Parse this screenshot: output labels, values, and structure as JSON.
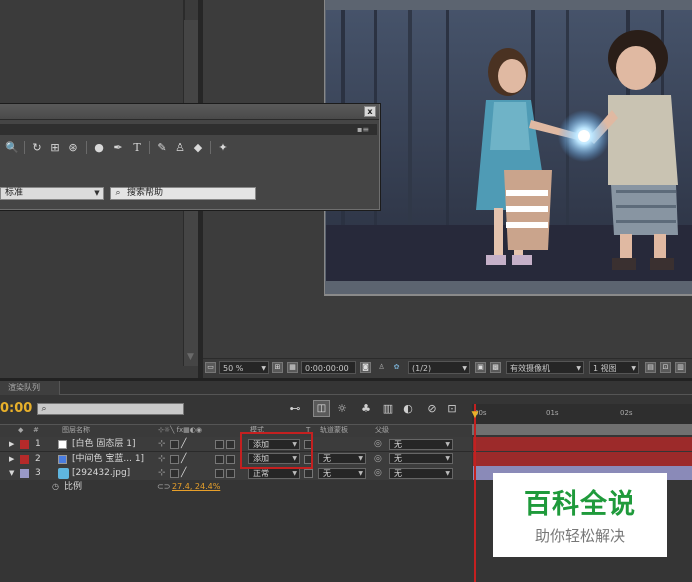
{
  "tools_panel": {
    "workspace_select": "标准",
    "help_search_placeholder": "搜索帮助",
    "close_label": "x",
    "menu_glyph": "▪≡",
    "tools": [
      {
        "name": "zoom-tool-icon",
        "glyph": "🔍"
      },
      {
        "name": "rotate-tool-icon",
        "glyph": "↻"
      },
      {
        "name": "camera-orbit-tool-icon",
        "glyph": "⊞"
      },
      {
        "name": "pan-behind-tool-icon",
        "glyph": "⊛"
      },
      {
        "name": "ellipse-tool-icon",
        "glyph": "●"
      },
      {
        "name": "pen-tool-icon",
        "glyph": "✒"
      },
      {
        "name": "type-tool-icon",
        "glyph": "T"
      },
      {
        "name": "brush-tool-icon",
        "glyph": "✎"
      },
      {
        "name": "clone-stamp-tool-icon",
        "glyph": "♙"
      },
      {
        "name": "eraser-tool-icon",
        "glyph": "◆"
      },
      {
        "name": "puppet-pin-tool-icon",
        "glyph": "✦"
      }
    ]
  },
  "viewer_toolbar": {
    "zoom": "50 %",
    "timecode": "0:00:00:00",
    "resolution": "(1/2)",
    "camera": "有效摄像机",
    "view_layout": "1 视图"
  },
  "timeline": {
    "tab_label": "渲染队列",
    "current_time": "0:00",
    "ruler_ticks": [
      "00s",
      "01s",
      "02s"
    ],
    "columns": {
      "number": "#",
      "layer_name": "图层名称",
      "mode": "模式",
      "trkmat": "T",
      "track_matte": "轨道蒙板",
      "parent": "父级"
    },
    "layers": [
      {
        "index": "1",
        "name": "[白色 固态层 1]",
        "mode": "添加",
        "track_matte": "",
        "parent": "无",
        "label_color": "#b52a2a",
        "swatch_color": "#ffffff",
        "bar_color": "#9c2a2a"
      },
      {
        "index": "2",
        "name": "[中间色 宝蓝... 1]",
        "mode": "添加",
        "track_matte": "无",
        "parent": "无",
        "label_color": "#b52a2a",
        "swatch_color": "#4a7de0",
        "bar_color": "#9c2a2a"
      },
      {
        "index": "3",
        "name": "[292432.jpg]",
        "mode": "正常",
        "track_matte": "无",
        "parent": "无",
        "label_color": "#9a9ac8",
        "swatch_color": "#5fb6e0",
        "bar_color": "#8a8ab8"
      }
    ],
    "property": {
      "name": "比例",
      "value": "27.4, 24.4%"
    }
  },
  "watermark": {
    "title": "百科全说",
    "subtitle": "助你轻松解决"
  }
}
